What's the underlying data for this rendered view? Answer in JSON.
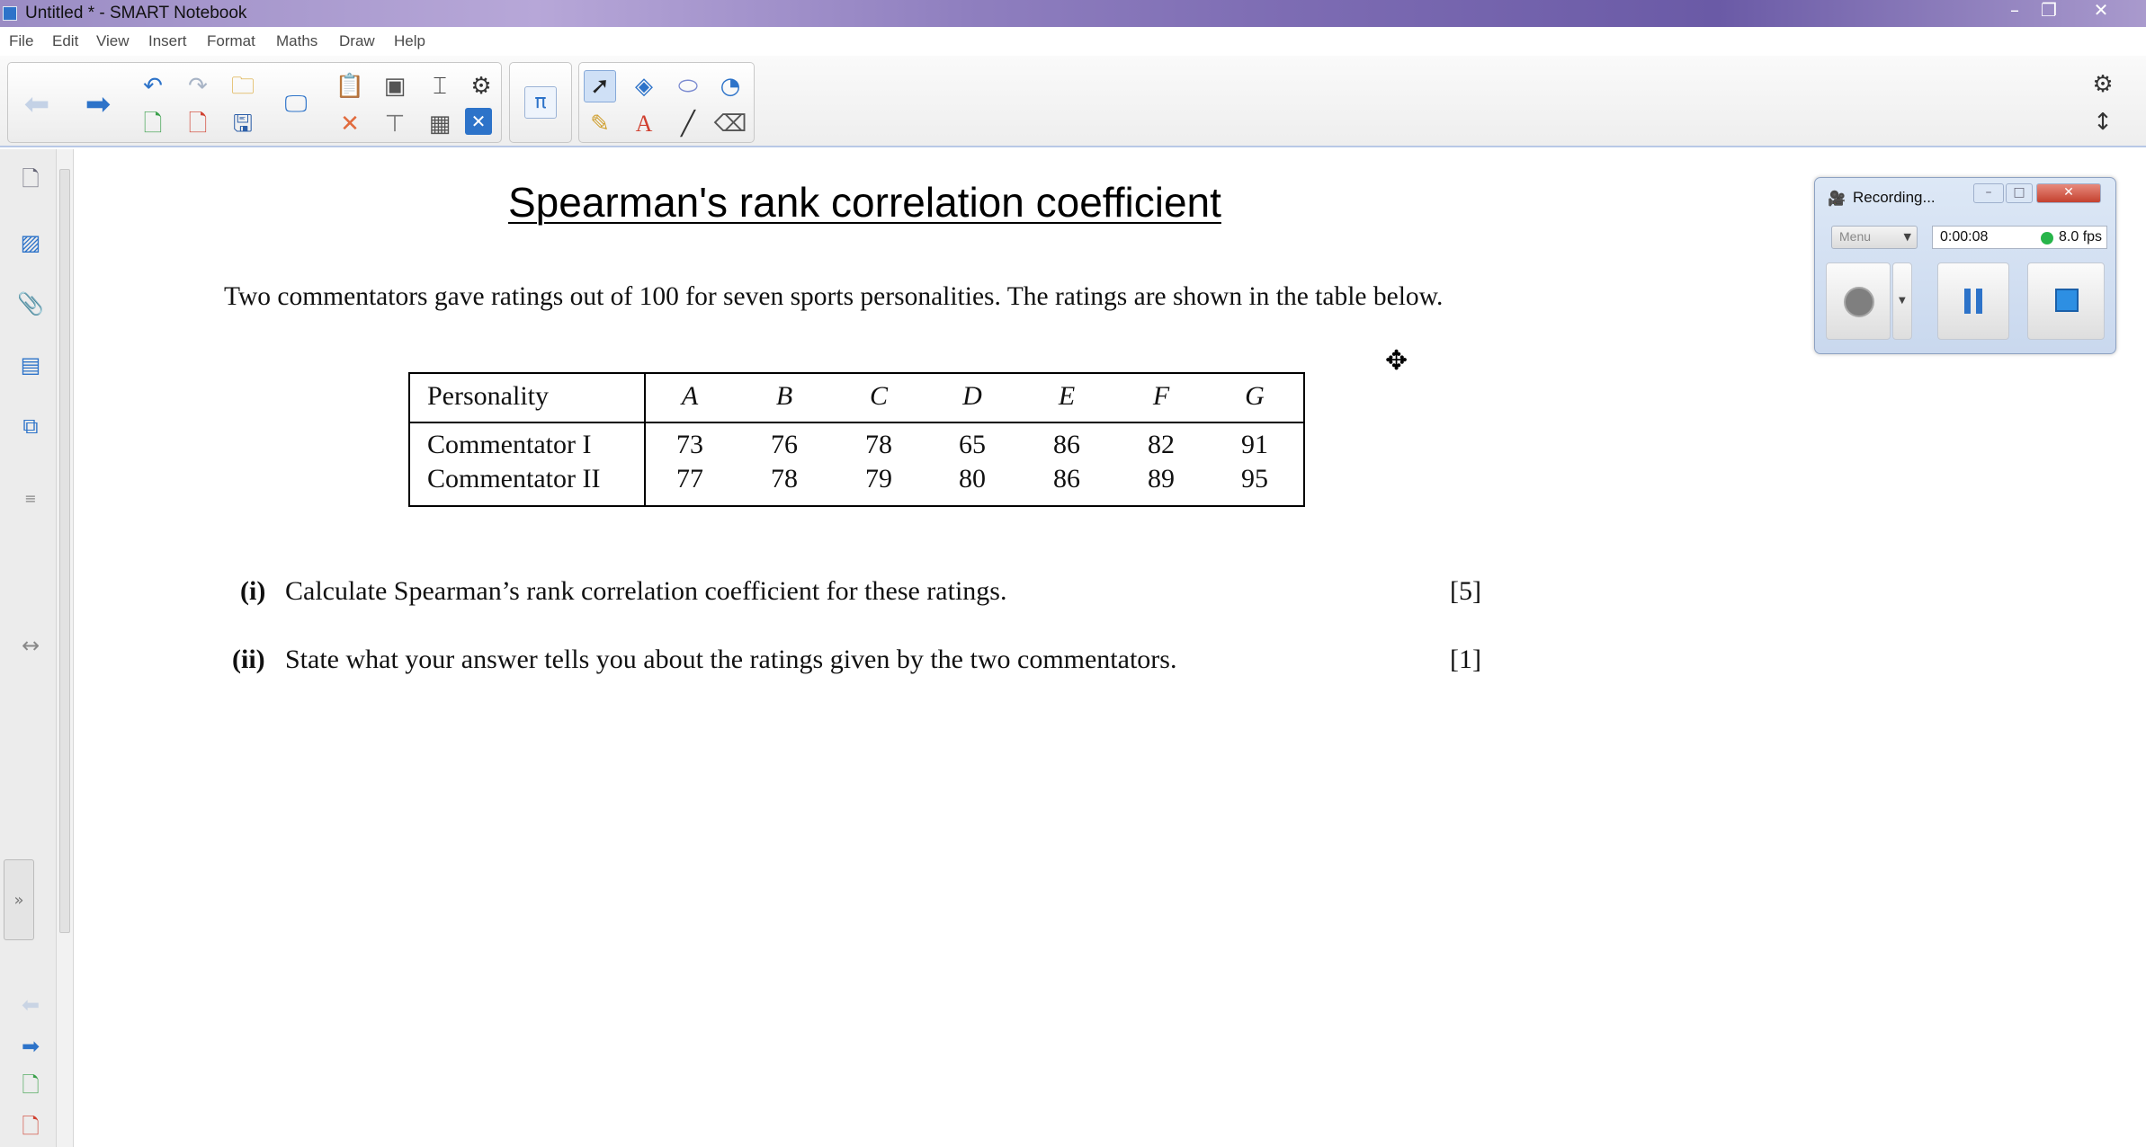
{
  "window": {
    "title": "Untitled * - SMART Notebook",
    "minimize": "–",
    "maximize": "❐",
    "close": "✕"
  },
  "menu": [
    "File",
    "Edit",
    "View",
    "Insert",
    "Format",
    "Maths",
    "Draw",
    "Help"
  ],
  "toolbar": {
    "math_symbol": "π",
    "text_tool": "A"
  },
  "document": {
    "title": "Spearman's rank correlation coefficient",
    "intro": "Two commentators gave ratings out of 100 for seven sports personalities.  The ratings are shown in the table below.",
    "table": {
      "header_label": "Personality",
      "columns": [
        "A",
        "B",
        "C",
        "D",
        "E",
        "F",
        "G"
      ],
      "rows": [
        {
          "label": "Commentator I",
          "values": [
            "73",
            "76",
            "78",
            "65",
            "86",
            "82",
            "91"
          ]
        },
        {
          "label": "Commentator II",
          "values": [
            "77",
            "78",
            "79",
            "80",
            "86",
            "89",
            "95"
          ]
        }
      ]
    },
    "questions": [
      {
        "number": "(i)",
        "text": "Calculate Spearman’s rank correlation coefficient for these ratings.",
        "marks": "[5]"
      },
      {
        "number": "(ii)",
        "text": "State what your answer tells you about the ratings given by the two commentators.",
        "marks": "[1]"
      }
    ]
  },
  "recorder": {
    "title": "Recording...",
    "menu_label": "Menu",
    "elapsed": "0:00:08",
    "fps": "8.0 fps",
    "status_color": "#27b54a"
  },
  "colors": {
    "accent": "#2d73c9",
    "titlebar": "#8f7fbf",
    "selected_tool": "#cfe0f6"
  }
}
